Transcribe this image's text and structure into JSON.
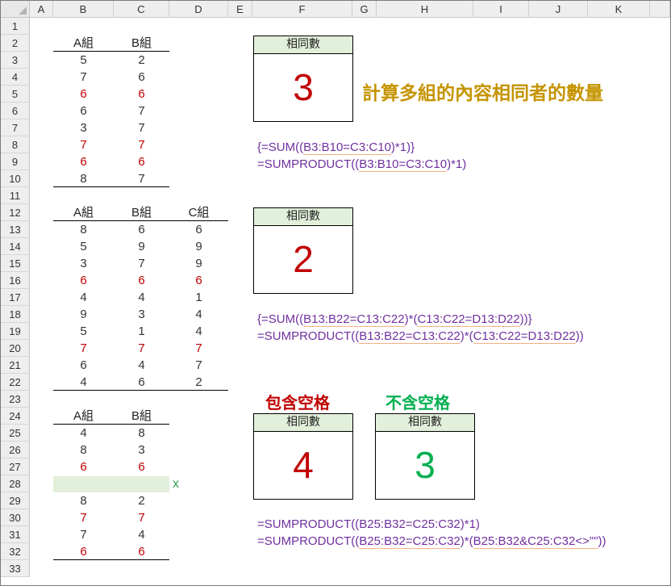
{
  "columns": [
    "A",
    "B",
    "C",
    "D",
    "E",
    "F",
    "G",
    "H",
    "I",
    "J",
    "K"
  ],
  "rows": [
    "1",
    "2",
    "3",
    "4",
    "5",
    "6",
    "7",
    "8",
    "9",
    "10",
    "11",
    "12",
    "13",
    "14",
    "15",
    "16",
    "17",
    "18",
    "19",
    "20",
    "21",
    "22",
    "23",
    "24",
    "25",
    "26",
    "27",
    "28",
    "29",
    "30",
    "31",
    "32",
    "33"
  ],
  "colors": {
    "red": "#c00000",
    "green": "#00b050",
    "purple": "#7030a0",
    "gold": "#c59400",
    "header_fill": "#e2efda"
  },
  "table1": {
    "headers": [
      "A組",
      "B組"
    ],
    "rows": [
      {
        "values": [
          "5",
          "2"
        ],
        "match": false
      },
      {
        "values": [
          "7",
          "6"
        ],
        "match": false
      },
      {
        "values": [
          "6",
          "6"
        ],
        "match": true
      },
      {
        "values": [
          "6",
          "7"
        ],
        "match": false
      },
      {
        "values": [
          "3",
          "7"
        ],
        "match": false
      },
      {
        "values": [
          "7",
          "7"
        ],
        "match": true
      },
      {
        "values": [
          "6",
          "6"
        ],
        "match": true
      },
      {
        "values": [
          "8",
          "7"
        ],
        "match": false
      }
    ]
  },
  "table2": {
    "headers": [
      "A組",
      "B組",
      "C組"
    ],
    "rows": [
      {
        "values": [
          "8",
          "6",
          "6"
        ],
        "match": false
      },
      {
        "values": [
          "5",
          "9",
          "9"
        ],
        "match": false
      },
      {
        "values": [
          "3",
          "7",
          "9"
        ],
        "match": false
      },
      {
        "values": [
          "6",
          "6",
          "6"
        ],
        "match": true
      },
      {
        "values": [
          "4",
          "4",
          "1"
        ],
        "match": false
      },
      {
        "values": [
          "9",
          "3",
          "4"
        ],
        "match": false
      },
      {
        "values": [
          "5",
          "1",
          "4"
        ],
        "match": false
      },
      {
        "values": [
          "7",
          "7",
          "7"
        ],
        "match": true
      },
      {
        "values": [
          "6",
          "4",
          "7"
        ],
        "match": false
      },
      {
        "values": [
          "4",
          "6",
          "2"
        ],
        "match": false
      }
    ]
  },
  "table3": {
    "headers": [
      "A組",
      "B組"
    ],
    "rows": [
      {
        "values": [
          "4",
          "8"
        ],
        "match": false
      },
      {
        "values": [
          "8",
          "3"
        ],
        "match": false
      },
      {
        "values": [
          "6",
          "6"
        ],
        "match": true
      },
      {
        "values": [
          "",
          ""
        ],
        "match": false,
        "blank": true
      },
      {
        "values": [
          "8",
          "2"
        ],
        "match": false
      },
      {
        "values": [
          "7",
          "7"
        ],
        "match": true
      },
      {
        "values": [
          "7",
          "4"
        ],
        "match": false
      },
      {
        "values": [
          "6",
          "6"
        ],
        "match": true
      }
    ],
    "blank_marker": "x"
  },
  "box1": {
    "title": "相同數",
    "value": "3"
  },
  "box2": {
    "title": "相同數",
    "value": "2"
  },
  "box3": {
    "title": "相同數",
    "value": "4"
  },
  "box4": {
    "title": "相同數",
    "value": "3"
  },
  "main_title": "計算多組的內容相同者的數量",
  "label_with_blank": "包含空格",
  "label_without_blank": "不含空格",
  "formulas": {
    "f1": [
      "{=SUM((",
      "B3:B10=C3:C10",
      ")*1)}"
    ],
    "f2": [
      "=SUMPRODUCT((",
      "B3:B10=C3:C10",
      ")*1)"
    ],
    "f3": [
      "{=SUM((",
      "B13:B22=C13:C22",
      ")*(",
      "C13:C22=D13:D22",
      "))}"
    ],
    "f4": [
      "=SUMPRODUCT((",
      "B13:B22=C13:C22",
      ")*(",
      "C13:C22=D13:D22",
      "))"
    ],
    "f5": [
      "=SUMPRODUCT((B25:B32=C25:C32)*1)"
    ],
    "f6": [
      "=SUMPRODUCT((",
      "B25:B32=C25:C32",
      ")*(",
      "B25:B32&C25:C32<>\"\"",
      "))"
    ]
  }
}
